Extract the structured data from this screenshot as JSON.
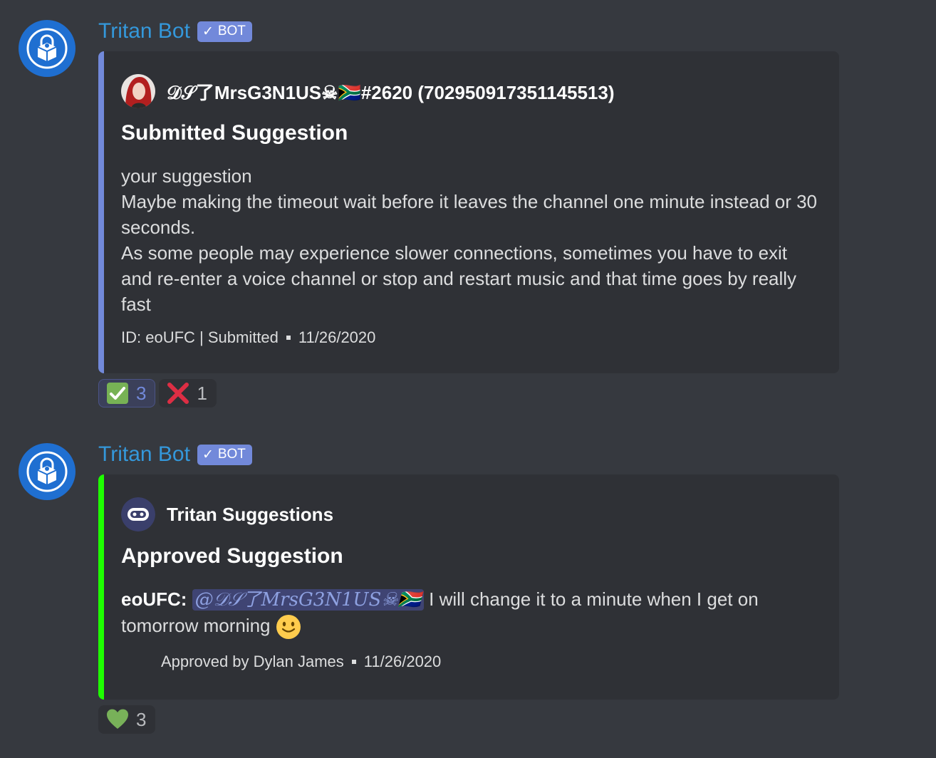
{
  "messages": [
    {
      "username": "Tritan Bot",
      "bot_tag": "BOT",
      "embed": {
        "color": "#7289da",
        "author": "𝒟𝒮了MrsG3N1US☠🇿🇦#2620 (702950917351145513)",
        "title": "Submitted Suggestion",
        "description_lines": [
          "your suggestion",
          "Maybe making the timeout wait before it leaves the channel one minute instead or 30 seconds.",
          "As some people may experience slower connections, sometimes you have to exit and re-enter a voice channel or stop and restart music and that time goes by really fast"
        ],
        "footer_text": "ID: eoUFC | Submitted",
        "footer_date": "11/26/2020"
      },
      "reactions": [
        {
          "emoji": "white-check-mark",
          "count": "3",
          "me": true
        },
        {
          "emoji": "cross-mark",
          "count": "1",
          "me": false
        }
      ]
    },
    {
      "username": "Tritan Bot",
      "bot_tag": "BOT",
      "embed": {
        "color": "#00ff00",
        "author": "Tritan Suggestions",
        "title": "Approved Suggestion",
        "desc_prefix": "eoUFC:",
        "mention": "@𝒟𝒮了MrsG3N1US☠🇿🇦",
        "desc_text": " I will change it to a minute when I get on tomorrow morning",
        "footer_text": "Approved by Dylan James",
        "footer_date": "11/26/2020"
      },
      "reactions": [
        {
          "emoji": "green-heart",
          "count": "3",
          "me": false
        }
      ]
    }
  ]
}
